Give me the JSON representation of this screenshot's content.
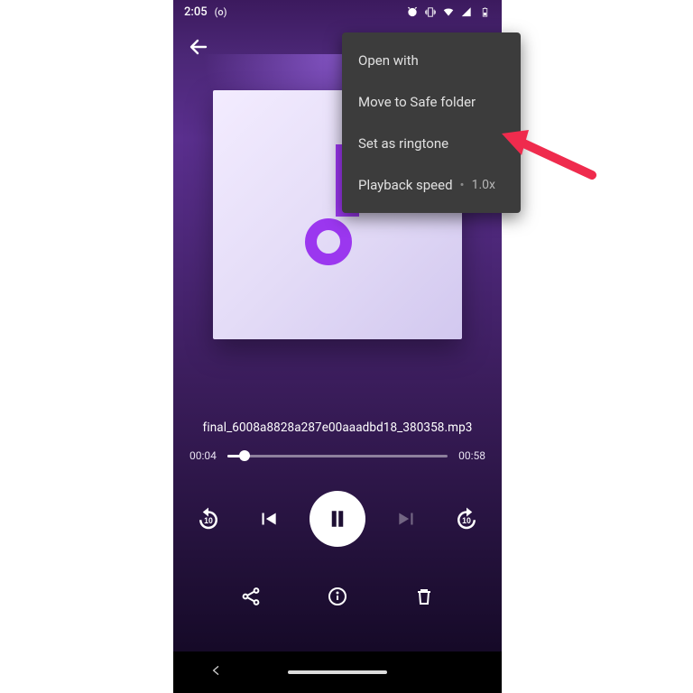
{
  "status": {
    "time": "2:05",
    "left_icon": "(o)"
  },
  "menu": {
    "open_with": "Open with",
    "move_safe": "Move to Safe folder",
    "set_ringtone": "Set as ringtone",
    "playback_speed": "Playback speed",
    "playback_value": "1.0x"
  },
  "player": {
    "filename": "final_6008a8828a287e00aaadbd18_380358.mp3",
    "elapsed": "00:04",
    "duration": "00:58",
    "progress_pct": 8
  }
}
